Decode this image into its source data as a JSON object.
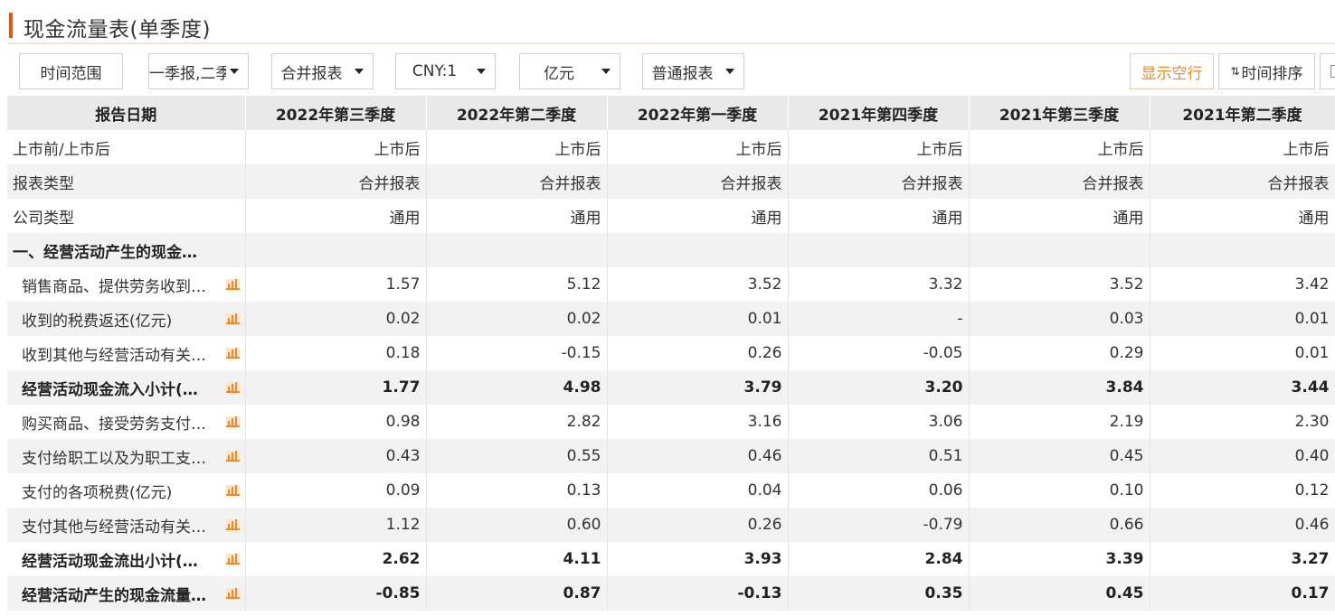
{
  "title": "现金流量表(单季度)",
  "toolbar": {
    "time_range": "时间范围",
    "report_period": "一季报,二季",
    "report_scope": "合并报表",
    "currency": "CNY:1",
    "unit": "亿元",
    "report_kind": "普通报表",
    "show_empty_rows": "显示空行",
    "time_sort": "时间排序"
  },
  "table": {
    "header_label": "报告日期",
    "columns": [
      "2022年第三季度",
      "2022年第二季度",
      "2022年第一季度",
      "2021年第四季度",
      "2021年第三季度",
      "2021年第二季度"
    ],
    "rows": [
      {
        "label": "上市前/上市后",
        "values": [
          "上市后",
          "上市后",
          "上市后",
          "上市后",
          "上市后",
          "上市后"
        ]
      },
      {
        "label": "报表类型",
        "values": [
          "合并报表",
          "合并报表",
          "合并报表",
          "合并报表",
          "合并报表",
          "合并报表"
        ]
      },
      {
        "label": "公司类型",
        "values": [
          "通用",
          "通用",
          "通用",
          "通用",
          "通用",
          "通用"
        ]
      },
      {
        "label": "一、经营活动产生的现金流量:",
        "values": [
          "",
          "",
          "",
          "",
          "",
          ""
        ],
        "section": true
      },
      {
        "label": "销售商品、提供劳务收到…",
        "values": [
          "1.57",
          "5.12",
          "3.52",
          "3.32",
          "3.52",
          "3.42"
        ],
        "chart": true
      },
      {
        "label": "收到的税费返还(亿元)",
        "values": [
          "0.02",
          "0.02",
          "0.01",
          "-",
          "0.03",
          "0.01"
        ],
        "chart": true
      },
      {
        "label": "收到其他与经营活动有关…",
        "values": [
          "0.18",
          "-0.15",
          "0.26",
          "-0.05",
          "0.29",
          "0.01"
        ],
        "chart": true
      },
      {
        "label": "经营活动现金流入小计(…",
        "values": [
          "1.77",
          "4.98",
          "3.79",
          "3.20",
          "3.84",
          "3.44"
        ],
        "chart": true,
        "bold": true
      },
      {
        "label": "购买商品、接受劳务支付…",
        "values": [
          "0.98",
          "2.82",
          "3.16",
          "3.06",
          "2.19",
          "2.30"
        ],
        "chart": true
      },
      {
        "label": "支付给职工以及为职工支…",
        "values": [
          "0.43",
          "0.55",
          "0.46",
          "0.51",
          "0.45",
          "0.40"
        ],
        "chart": true
      },
      {
        "label": "支付的各项税费(亿元)",
        "values": [
          "0.09",
          "0.13",
          "0.04",
          "0.06",
          "0.10",
          "0.12"
        ],
        "chart": true
      },
      {
        "label": "支付其他与经营活动有关…",
        "values": [
          "1.12",
          "0.60",
          "0.26",
          "-0.79",
          "0.66",
          "0.46"
        ],
        "chart": true
      },
      {
        "label": "经营活动现金流出小计(…",
        "values": [
          "2.62",
          "4.11",
          "3.93",
          "2.84",
          "3.39",
          "3.27"
        ],
        "chart": true,
        "bold": true
      },
      {
        "label": "经营活动产生的现金流量…",
        "values": [
          "-0.85",
          "0.87",
          "-0.13",
          "0.35",
          "0.45",
          "0.17"
        ],
        "chart": true,
        "bold": true
      }
    ]
  },
  "colors": {
    "accent": "#e8530e",
    "orange_button": "#f08a24",
    "header_bg": "#e9e9e9",
    "alt_row_bg": "#f2f2f2"
  },
  "icons": {
    "row_chart": "bar-chart-icon",
    "dropdown": "chevron-down-icon",
    "sort": "sort-arrows-icon"
  }
}
